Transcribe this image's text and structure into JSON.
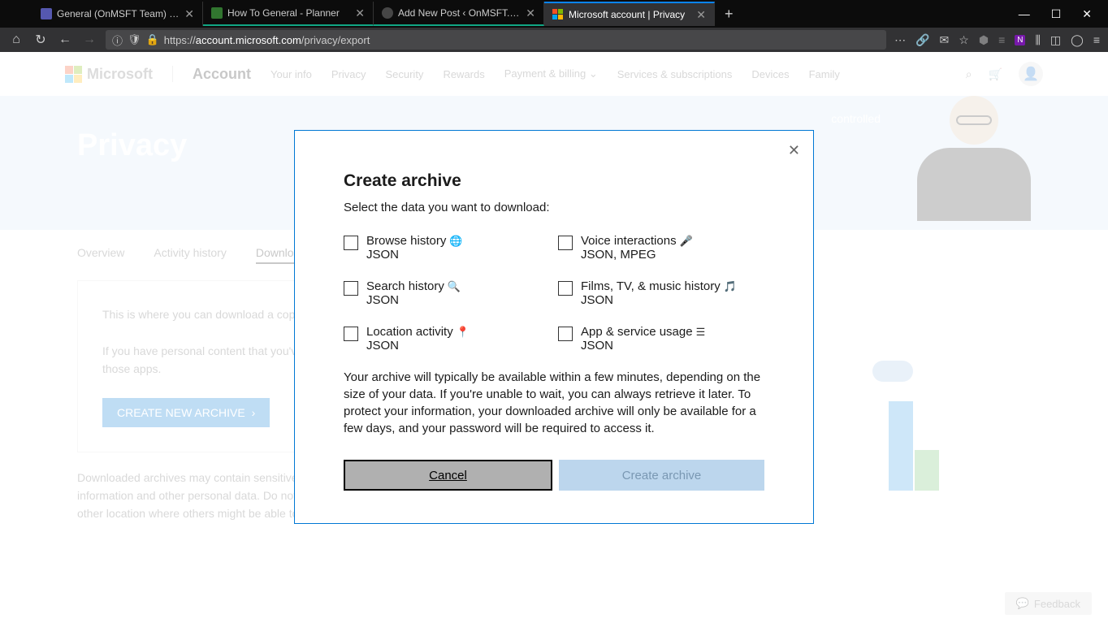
{
  "browser": {
    "tabs": [
      {
        "title": "General (OnMSFT Team) | Micr",
        "active": false
      },
      {
        "title": "How To General - Planner",
        "active": false
      },
      {
        "title": "Add New Post ‹ OnMSFT.com — W",
        "active": false
      },
      {
        "title": "Microsoft account | Privacy",
        "active": true
      }
    ],
    "url_prefix": "https://",
    "url_domain": "account.microsoft.com",
    "url_path": "/privacy/export"
  },
  "header": {
    "brand": "Microsoft",
    "account": "Account",
    "nav": [
      "Your info",
      "Privacy",
      "Security",
      "Rewards",
      "Payment & billing",
      "Services & subscriptions",
      "Devices",
      "Family"
    ]
  },
  "hero": {
    "title": "Privacy",
    "tagline": "controlled"
  },
  "subnav": {
    "items": [
      "Overview",
      "Activity history",
      "Download your data"
    ]
  },
  "content": {
    "p1": "This is where you can download a copy of the data from the activity history page.",
    "p2": "If you have personal content that you've stored on Microsoft apps – such as your email, calendar and photos – you can access it from those apps.",
    "button": "CREATE NEW ARCHIVE",
    "footer": "Downloaded archives may contain sensitive content, such as your search history, location information and other personal data. Do not download your archive to a public computer or any other location where others might be able to access it."
  },
  "modal": {
    "title": "Create archive",
    "subtitle": "Select the data you want to download:",
    "options": [
      {
        "label": "Browse history",
        "format": "JSON",
        "icon": "globe"
      },
      {
        "label": "Voice interactions",
        "format": "JSON, MPEG",
        "icon": "mic"
      },
      {
        "label": "Search history",
        "format": "JSON",
        "icon": "search"
      },
      {
        "label": "Films, TV, & music history",
        "format": "JSON",
        "icon": "media"
      },
      {
        "label": "Location activity",
        "format": "JSON",
        "icon": "location"
      },
      {
        "label": "App & service usage",
        "format": "JSON",
        "icon": "list"
      }
    ],
    "note": "Your archive will typically be available within a few minutes, depending on the size of your data. If you're unable to wait, you can always retrieve it later. To protect your information, your downloaded archive will only be available for a few days, and your password will be required to access it.",
    "cancel": "Cancel",
    "create": "Create archive"
  },
  "feedback": "Feedback"
}
